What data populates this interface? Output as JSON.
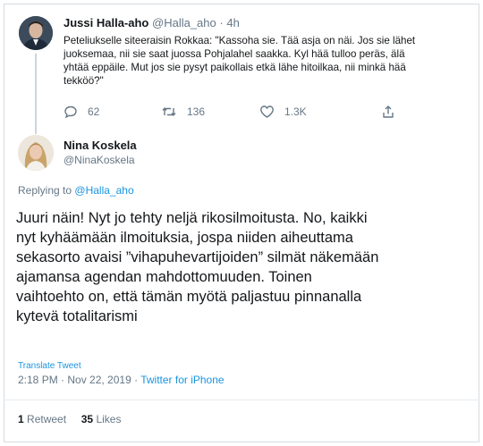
{
  "tweet1": {
    "name": "Jussi Halla-aho",
    "handle": "@Halla_aho",
    "separator": "·",
    "time": "4h",
    "lines": [
      "Peteliukselle siteeraisin Rokkaa: \"Kassoha sie. Tää asja on näi. Jos sie lähet",
      "juoksemaa, nii sie saat juossa Pohjalahel saakka. Kyl hää tulloo peräs, älä",
      "yhtää eppäile. Mut jos sie pysyt paikollais etkä lähe hitoilkaa, nii minkä hää",
      "tekköö?\""
    ],
    "replies": "62",
    "retweets": "136",
    "likes": "1.3K",
    "icons": [
      "reply-icon",
      "retweet-icon",
      "like-icon",
      "share-icon"
    ]
  },
  "tweet2": {
    "name": "Nina Koskela",
    "handle": "@NinaKoskela",
    "replying_prefix": "Replying to",
    "replying_to": "@Halla_aho",
    "lines": [
      "Juuri näin! Nyt jo tehty neljä rikosilmoitusta. No, kaikki",
      "nyt kyhäämään ilmoituksia, jospa niiden aiheuttama",
      "sekasorto avaisi ”vihapuhevartijoiden” silmät näkemään",
      "ajamansa agendan mahdottomuuden. Toinen",
      "vaihtoehto on, että tämän myötä paljastuu pinnanalla",
      "kytevä totalitarismi"
    ],
    "translate": "Translate Tweet",
    "time": "2:18 PM · Nov 22, 2019 ·",
    "source": "Twitter for iPhone",
    "retweets_count": "1",
    "retweets_label": "Retweet",
    "likes_count": "35",
    "likes_label": "Likes"
  },
  "colors": {
    "link": "#1b95e0",
    "muted": "#657786",
    "text": "#14171a",
    "border": "#e6ecf0"
  }
}
